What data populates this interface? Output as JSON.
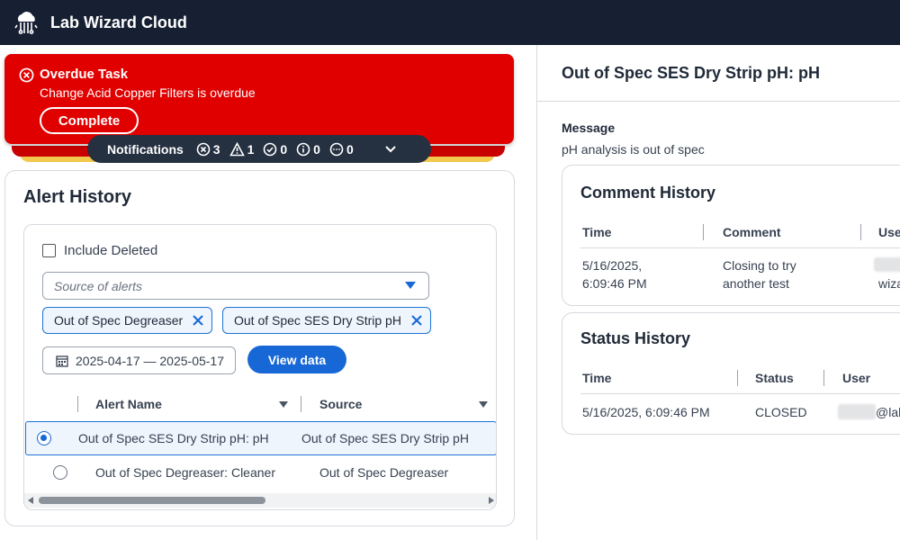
{
  "app": {
    "title": "Lab Wizard Cloud",
    "logo_icon": "cloud-flask-icon"
  },
  "notification": {
    "title": "Overdue Task",
    "message": "Change Acid Copper Filters is overdue",
    "action_label": "Complete",
    "bar": {
      "label": "Notifications",
      "counts": {
        "error": "3",
        "warning": "1",
        "success": "0",
        "info": "0",
        "other": "0"
      }
    },
    "colors": {
      "error": "#e00000",
      "bar": "#253041"
    }
  },
  "alert_history": {
    "title": "Alert History",
    "include_deleted_label": "Include Deleted",
    "source_placeholder": "Source of alerts",
    "chips": [
      "Out of Spec Degreaser",
      "Out of Spec SES Dry Strip pH"
    ],
    "date_range": "2025-04-17 — 2025-05-17",
    "view_button": "View data",
    "columns": [
      "Alert Name",
      "Source"
    ],
    "rows": [
      {
        "name": "Out of Spec SES Dry Strip pH: pH",
        "source": "Out of Spec SES Dry Strip pH",
        "selected": true
      },
      {
        "name": "Out of Spec Degreaser: Cleaner",
        "source": "Out of Spec Degreaser",
        "selected": false
      }
    ]
  },
  "detail": {
    "title": "Out of Spec SES Dry Strip pH: pH",
    "message_label": "Message",
    "message": "pH analysis is out of spec",
    "comment_history": {
      "title": "Comment History",
      "columns": [
        "Time",
        "Comment",
        "Use"
      ],
      "rows": [
        {
          "time_line1": "5/16/2025,",
          "time_line2": "6:09:46 PM",
          "comment_line1": "Closing to try",
          "comment_line2": "another test",
          "user": "wiza"
        }
      ]
    },
    "status_history": {
      "title": "Status History",
      "columns": [
        "Time",
        "Status",
        "User"
      ],
      "rows": [
        {
          "time": "5/16/2025, 6:09:46 PM",
          "status": "CLOSED",
          "user": "@lab"
        }
      ]
    }
  },
  "colors": {
    "accent": "#1768d6",
    "topbar": "#172033"
  }
}
